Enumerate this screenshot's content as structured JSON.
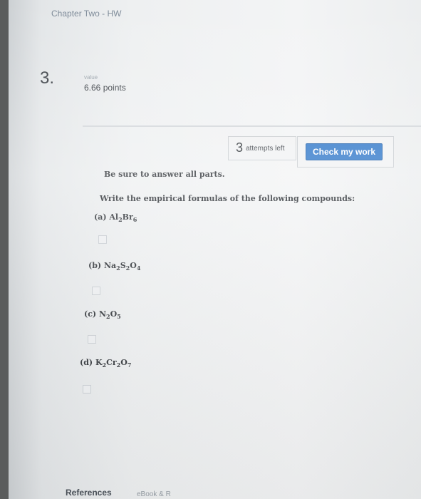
{
  "header": {
    "title": "Chapter Two - HW"
  },
  "question": {
    "number": "3.",
    "value_label": "value",
    "points": "6.66 points"
  },
  "attempts": {
    "count": "3",
    "label": "attempts left"
  },
  "check_button": {
    "label": "Check my work"
  },
  "instructions": {
    "line1": "Be sure to answer all parts.",
    "line2": "Write the empirical formulas of the following compounds:"
  },
  "parts": [
    {
      "label": "(a) ",
      "formula_parts": [
        [
          "Al",
          ""
        ],
        [
          "",
          "2"
        ],
        [
          "Br",
          ""
        ],
        [
          "",
          "6"
        ]
      ]
    },
    {
      "label": "(b) ",
      "formula_parts": [
        [
          "Na",
          ""
        ],
        [
          "",
          "2"
        ],
        [
          "S",
          ""
        ],
        [
          "",
          "2"
        ],
        [
          "O",
          ""
        ],
        [
          "",
          "4"
        ]
      ]
    },
    {
      "label": "(c) ",
      "formula_parts": [
        [
          "N",
          ""
        ],
        [
          "",
          "2"
        ],
        [
          "O",
          ""
        ],
        [
          "",
          "5"
        ]
      ]
    },
    {
      "label": "(d) ",
      "formula_parts": [
        [
          "K",
          ""
        ],
        [
          "",
          "2"
        ],
        [
          "Cr",
          ""
        ],
        [
          "",
          "2"
        ],
        [
          "O",
          ""
        ],
        [
          "",
          "7"
        ]
      ]
    }
  ],
  "footer": {
    "references_label": "References",
    "ebook_label": "eBook & R"
  }
}
